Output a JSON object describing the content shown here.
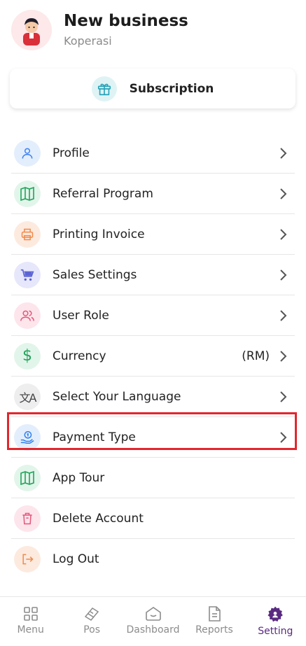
{
  "header": {
    "business_name": "New business",
    "business_type": "Koperasi"
  },
  "subscription": {
    "label": "Subscription"
  },
  "menu": {
    "items": [
      {
        "label": "Profile",
        "icon": "user-icon",
        "color": "#3b82f6",
        "bg": "#e3eefc"
      },
      {
        "label": "Referral Program",
        "icon": "map-icon",
        "color": "#22a35a",
        "bg": "#e2f5ea"
      },
      {
        "label": "Printing Invoice",
        "icon": "printer-icon",
        "color": "#f08a4b",
        "bg": "#fdeadf"
      },
      {
        "label": "Sales Settings",
        "icon": "cart-icon",
        "color": "#5b63d3",
        "bg": "#e6e7fa"
      },
      {
        "label": "User Role",
        "icon": "users-icon",
        "color": "#e5577a",
        "bg": "#fde5ec"
      },
      {
        "label": "Currency",
        "value": "(RM)",
        "icon": "dollar-icon",
        "color": "#22a35a",
        "bg": "#e2f5ea"
      },
      {
        "label": "Select Your Language",
        "icon": "translate-icon",
        "color": "#444",
        "bg": "#eeeeee"
      },
      {
        "label": "Payment Type",
        "icon": "payment-hand-icon",
        "color": "#2f80ed",
        "bg": "#e3eefc"
      },
      {
        "label": "App Tour",
        "icon": "map-icon",
        "color": "#22a35a",
        "bg": "#e2f5ea"
      },
      {
        "label": "Delete Account",
        "icon": "trash-icon",
        "color": "#e5577a",
        "bg": "#fde5ec"
      },
      {
        "label": "Log Out",
        "icon": "logout-icon",
        "color": "#f08a4b",
        "bg": "#fdeadf"
      }
    ]
  },
  "tabs": [
    {
      "label": "Menu",
      "icon": "grid-icon"
    },
    {
      "label": "Pos",
      "icon": "card-terminal-icon"
    },
    {
      "label": "Dashboard",
      "icon": "home-icon"
    },
    {
      "label": "Reports",
      "icon": "document-icon"
    },
    {
      "label": "Setting",
      "icon": "gear-icon",
      "active": true
    }
  ],
  "colors": {
    "accent": "#5a2a82",
    "highlight": "#e3262d"
  }
}
